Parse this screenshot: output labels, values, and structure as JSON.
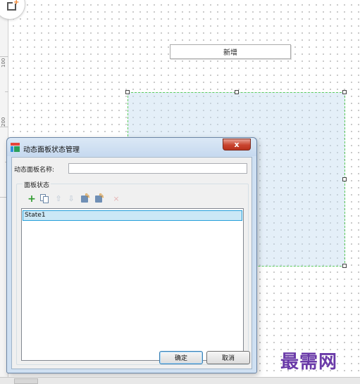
{
  "canvas": {
    "widget_label": "新增",
    "ruler": {
      "marks": [
        "100",
        "200"
      ]
    }
  },
  "dialog": {
    "title": "动态面板状态管理",
    "close_label": "x",
    "name_label": "动态面板名称:",
    "name_value": "",
    "states_group_label": "面板状态",
    "toolbar": {
      "add": "+",
      "up": "⇧",
      "down": "⇩",
      "delete": "×"
    },
    "states": [
      "State1"
    ],
    "ok_label": "确定",
    "cancel_label": "取消"
  },
  "watermark": "最需网",
  "colors": {
    "panel_fill": "#c3dcf0",
    "panel_border": "#5ccc5c",
    "selected_row": "#cbe8f6",
    "watermark": "#6a3aa8"
  }
}
